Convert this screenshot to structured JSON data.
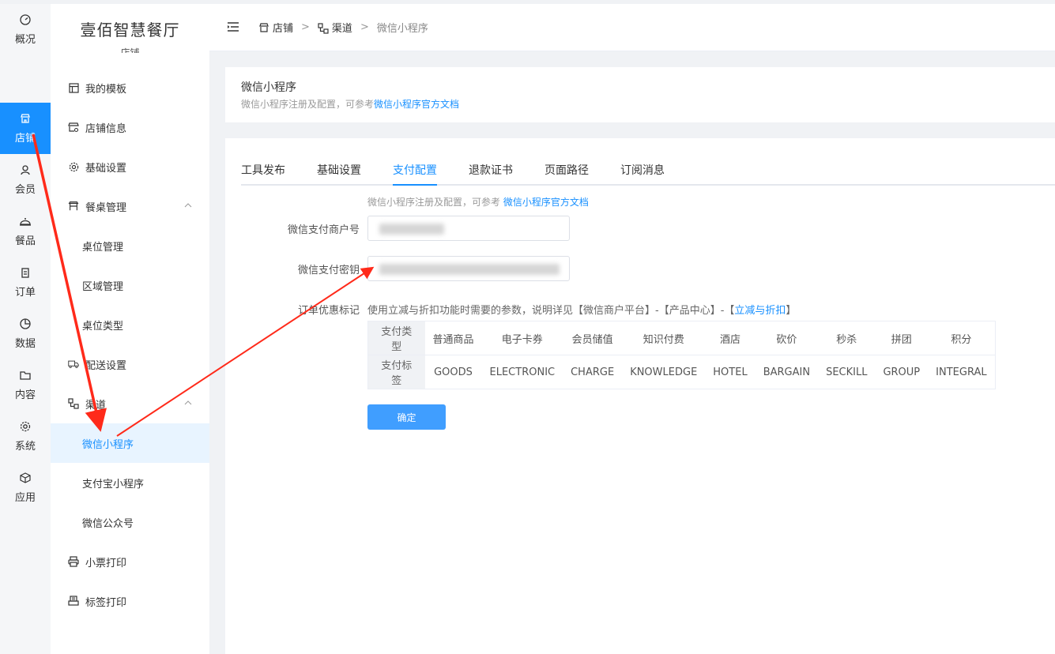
{
  "app": {
    "name": "壹佰智慧餐厅",
    "section": "店铺"
  },
  "rail": [
    {
      "label": "概况",
      "icon": "dashboard-icon"
    },
    {
      "label": "店铺",
      "icon": "store-icon",
      "active": true
    },
    {
      "label": "会员",
      "icon": "user-icon"
    },
    {
      "label": "餐品",
      "icon": "cloche-icon"
    },
    {
      "label": "订单",
      "icon": "clipboard-icon"
    },
    {
      "label": "数据",
      "icon": "pie-chart-icon"
    },
    {
      "label": "内容",
      "icon": "folder-icon"
    },
    {
      "label": "系统",
      "icon": "gear-icon"
    },
    {
      "label": "应用",
      "icon": "cube-icon"
    }
  ],
  "sidebar": {
    "items": [
      {
        "label": "我的模板",
        "icon": "template-icon"
      },
      {
        "label": "店铺信息",
        "icon": "store-info-icon"
      },
      {
        "label": "基础设置",
        "icon": "gear-icon"
      },
      {
        "label": "餐桌管理",
        "icon": "table-icon",
        "expanded": true
      },
      {
        "label": "桌位管理"
      },
      {
        "label": "区域管理"
      },
      {
        "label": "桌位类型"
      },
      {
        "label": "配送设置",
        "icon": "truck-icon"
      },
      {
        "label": "渠道",
        "icon": "channel-icon",
        "expanded": true
      },
      {
        "label": "微信小程序",
        "active": true
      },
      {
        "label": "支付宝小程序"
      },
      {
        "label": "微信公众号"
      },
      {
        "label": "小票打印",
        "icon": "printer-icon"
      },
      {
        "label": "标签打印",
        "icon": "label-printer-icon"
      }
    ]
  },
  "header": {
    "breadcrumb": [
      {
        "label": "店铺",
        "icon": "store-icon"
      },
      {
        "label": "渠道",
        "icon": "channel-icon"
      },
      {
        "label": "微信小程序"
      }
    ],
    "separator": ">"
  },
  "intro": {
    "title": "微信小程序",
    "desc": "微信小程序注册及配置，可参考",
    "link": "微信小程序官方文档"
  },
  "tabs": [
    "工具发布",
    "基础设置",
    "支付配置",
    "退款证书",
    "页面路径",
    "订阅消息"
  ],
  "active_tab": "支付配置",
  "form": {
    "hint": "微信小程序注册及配置，可参考",
    "hint_link": "微信小程序官方文档",
    "merchant_label": "微信支付商户号",
    "key_label": "微信支付密钥",
    "discount_label": "订单优惠标记",
    "discount_note_pre": "使用立减与折扣功能时需要的参数，说明详见【微信商户平台】-【产品中心】-【",
    "discount_note_link": "立减与折扣",
    "discount_note_post": "】",
    "submit": "确定"
  },
  "pay_table": {
    "type_header": "支付类型",
    "tag_header": "支付标签",
    "types": [
      "普通商品",
      "电子卡券",
      "会员储值",
      "知识付费",
      "酒店",
      "砍价",
      "秒杀",
      "拼团",
      "积分"
    ],
    "tags": [
      "GOODS",
      "ELECTRONIC",
      "CHARGE",
      "KNOWLEDGE",
      "HOTEL",
      "BARGAIN",
      "SECKILL",
      "GROUP",
      "INTEGRAL"
    ]
  },
  "colors": {
    "accent": "#1890ff",
    "button": "#409eff",
    "annotation": "#ff2a1a"
  }
}
